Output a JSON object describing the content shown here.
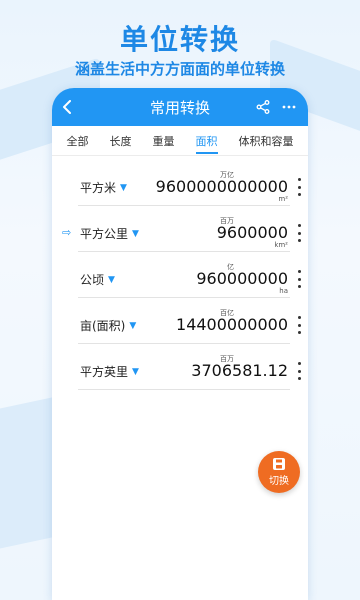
{
  "hero": {
    "title": "单位转换",
    "subtitle": "涵盖生活中方方面面的单位转换"
  },
  "appbar": {
    "title": "常用转换",
    "back_icon": "chevron-left-icon",
    "share_icon": "share-icon",
    "more_icon": "more-horizontal-icon"
  },
  "tabs": [
    {
      "label": "全部",
      "active": false
    },
    {
      "label": "长度",
      "active": false
    },
    {
      "label": "重量",
      "active": false
    },
    {
      "label": "面积",
      "active": true
    },
    {
      "label": "体积和容量",
      "active": false
    }
  ],
  "rows": [
    {
      "unit": "平方米",
      "magnitude": "万亿",
      "value": "9600000000000",
      "symbol": "m²",
      "selected": false
    },
    {
      "unit": "平方公里",
      "magnitude": "百万",
      "value": "9600000",
      "symbol": "km²",
      "selected": true
    },
    {
      "unit": "公顷",
      "magnitude": "亿",
      "value": "960000000",
      "symbol": "ha",
      "selected": false
    },
    {
      "unit": "亩(面积)",
      "magnitude": "百亿",
      "value": "14400000000",
      "symbol": "",
      "selected": false
    },
    {
      "unit": "平方英里",
      "magnitude": "百万",
      "value": "3706581.12",
      "symbol": "",
      "selected": false
    }
  ],
  "fab": {
    "label": "切换",
    "icon": "save-disk-icon"
  },
  "colors": {
    "primary": "#2196f3",
    "hero_text": "#1e88e5",
    "fab": "#ef6c22"
  }
}
